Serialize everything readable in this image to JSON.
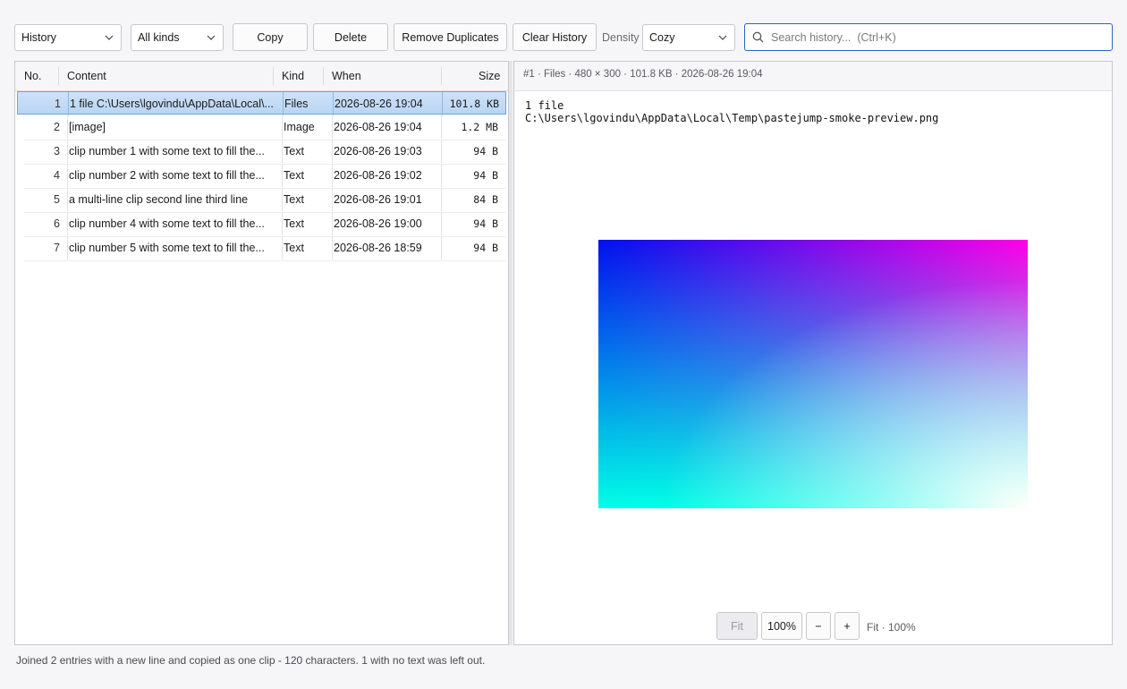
{
  "toolbar": {
    "view_select": "History",
    "kind_select": "All kinds",
    "copy_label": "Copy",
    "delete_label": "Delete",
    "remove_duplicates_label": "Remove Duplicates",
    "clear_history_label": "Clear History",
    "density_label": "Density",
    "density_select": "Cozy",
    "search_placeholder": "Search history...  (Ctrl+K)"
  },
  "table": {
    "columns": [
      "No.",
      "Content",
      "Kind",
      "When",
      "Size"
    ],
    "rows": [
      {
        "no": "1",
        "content": "1 file C:\\Users\\lgovindu\\AppData\\Local\\...",
        "kind": "Files",
        "when": "2026-08-26 19:04",
        "size": "101.8 KB",
        "selected": true
      },
      {
        "no": "2",
        "content": "[image]",
        "kind": "Image",
        "when": "2026-08-26 19:04",
        "size": "1.2 MB"
      },
      {
        "no": "3",
        "content": "clip number 1 with some text to fill the...",
        "kind": "Text",
        "when": "2026-08-26 19:03",
        "size": "94 B"
      },
      {
        "no": "4",
        "content": "clip number 2 with some text to fill the...",
        "kind": "Text",
        "when": "2026-08-26 19:02",
        "size": "94 B"
      },
      {
        "no": "5",
        "content": "a multi-line clip second line third line",
        "kind": "Text",
        "when": "2026-08-26 19:01",
        "size": "84 B"
      },
      {
        "no": "6",
        "content": "clip number 4 with some text to fill the...",
        "kind": "Text",
        "when": "2026-08-26 19:00",
        "size": "94 B"
      },
      {
        "no": "7",
        "content": "clip number 5 with some text to fill the...",
        "kind": "Text",
        "when": "2026-08-26 18:59",
        "size": "94 B"
      }
    ]
  },
  "preview": {
    "meta": "#1  ·  Files  ·  480 × 300  ·  101.8 KB  ·  2026-08-26 19:04",
    "text": "1 file\nC:\\Users\\lgovindu\\AppData\\Local\\Temp\\pastejump-smoke-preview.png",
    "fit_label": "Fit",
    "zoom_100_label": "100%",
    "zoom_out_label": "−",
    "zoom_in_label": "+",
    "zoom_status": "Fit · 100%"
  },
  "status": "Joined 2 entries with a new line and copied as one clip - 120 characters. 1 with no text was left out.",
  "colors": {
    "accent": "#2b63c6",
    "selection": "#b9d5f4"
  }
}
